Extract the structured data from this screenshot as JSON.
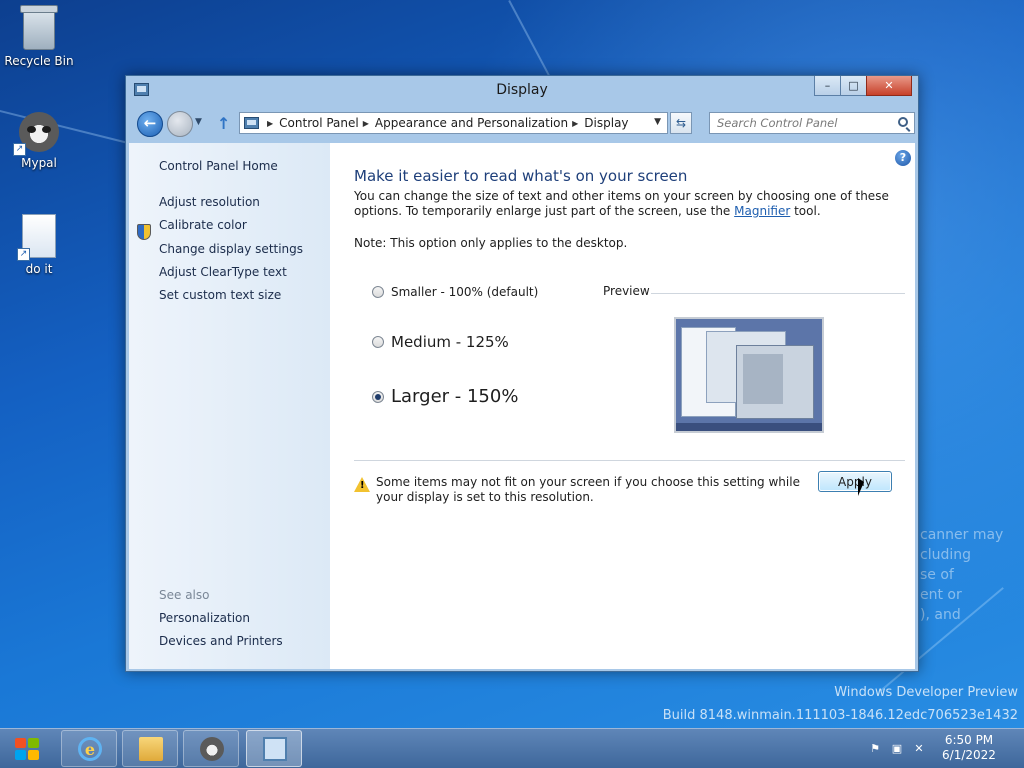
{
  "desktop": {
    "icons": [
      {
        "label": "Recycle Bin"
      },
      {
        "label": "Mypal"
      },
      {
        "label": "do it"
      }
    ],
    "watermark_line1": "Windows Developer Preview",
    "watermark_line2": "Build 8148.winmain.111103-1846.12edc706523e1432",
    "background_text": "canner may\ncluding\nse of\nent or\n), and"
  },
  "window": {
    "title": "Display",
    "buttons": {
      "minimize": "–",
      "maximize": "□",
      "close": "✕"
    },
    "address": {
      "crumbs": [
        "Control Panel",
        "Appearance and Personalization",
        "Display"
      ]
    },
    "search_placeholder": "Search Control Panel"
  },
  "left_pane": {
    "home": "Control Panel Home",
    "links": [
      "Adjust resolution",
      "Calibrate color",
      "Change display settings",
      "Adjust ClearType text",
      "Set custom text size"
    ],
    "see_also_label": "See also",
    "see_also": [
      "Personalization",
      "Devices and Printers"
    ]
  },
  "main": {
    "heading": "Make it easier to read what's on your screen",
    "desc_part1": "You can change the size of text and other items on your screen by choosing one of these options. To temporarily enlarge just part of the screen, use the ",
    "desc_link": "Magnifier",
    "desc_part2": " tool.",
    "note": "Note: This option only applies to the desktop.",
    "options": [
      {
        "label": "Smaller - 100% (default)",
        "selected": false
      },
      {
        "label": "Medium - 125%",
        "selected": false
      },
      {
        "label": "Larger - 150%",
        "selected": true
      }
    ],
    "preview_label": "Preview",
    "warning": "Some items may not fit on your screen if you choose this setting while your display is set to this resolution.",
    "apply_label": "Apply"
  },
  "taskbar": {
    "items": [
      "Internet Explorer",
      "Windows Explorer",
      "Mypal",
      "Display"
    ],
    "time": "6:50 PM",
    "date": "6/1/2022"
  },
  "colors": {
    "heading": "#1e3f7a",
    "link": "#1f5fb0",
    "close_button": "#c7412a"
  }
}
